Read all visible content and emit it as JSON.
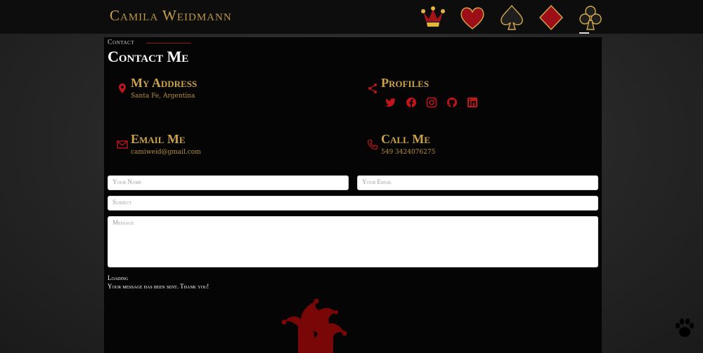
{
  "site": {
    "brand": "Camila Weidmann"
  },
  "nav": {
    "items": [
      "jester-icon",
      "heart-icon",
      "spade-icon",
      "diamond-icon",
      "club-icon"
    ]
  },
  "page": {
    "breadcrumb": "Contact",
    "title": "Contact Me"
  },
  "info": {
    "address": {
      "heading": "My Address",
      "value": "Santa Fe, Argentina"
    },
    "profiles": {
      "heading": "Profiles",
      "links": [
        "twitter-icon",
        "facebook-icon",
        "instagram-icon",
        "github-icon",
        "linkedin-icon"
      ]
    },
    "email": {
      "heading": "Email Me",
      "value": "camiweid@gmail.com"
    },
    "call": {
      "heading": "Call Me",
      "value": "549 3424076275"
    }
  },
  "form": {
    "name_placeholder": "Your Name",
    "email_placeholder": "Your Email",
    "subject_placeholder": "Subject",
    "message_placeholder": "Message",
    "loading": "Loading",
    "sent": "Your message has been sent. Thank you!"
  },
  "colors": {
    "accent_gold": "#c9a24a",
    "accent_red": "#c0151a",
    "panel": "#050505"
  }
}
